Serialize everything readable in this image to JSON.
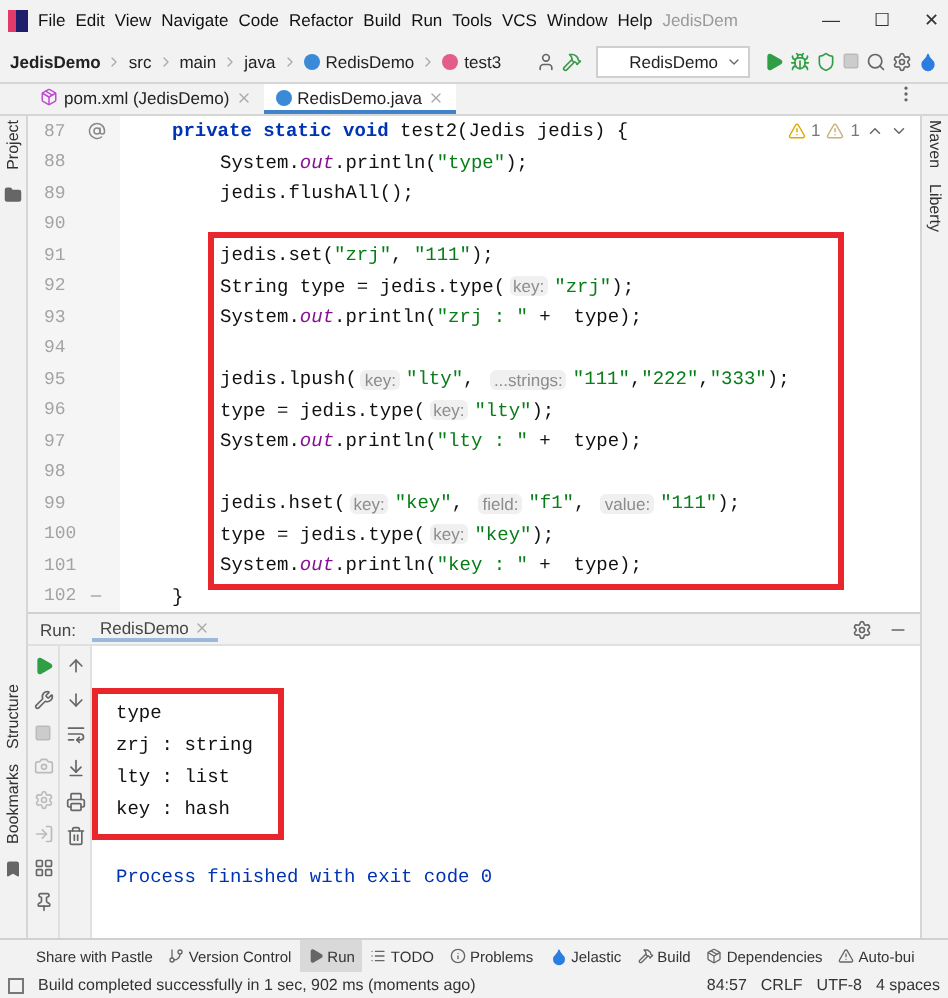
{
  "window": {
    "title": "JedisDem",
    "controls": [
      "—",
      "☐",
      "✕"
    ]
  },
  "menu": [
    "File",
    "Edit",
    "View",
    "Navigate",
    "Code",
    "Refactor",
    "Build",
    "Run",
    "Tools",
    "VCS",
    "Window",
    "Help"
  ],
  "breadcrumbs": [
    {
      "label": "JedisDemo",
      "kind": "project"
    },
    {
      "label": "src",
      "kind": "folder"
    },
    {
      "label": "main",
      "kind": "folder"
    },
    {
      "label": "java",
      "kind": "folder"
    },
    {
      "label": "RedisDemo",
      "kind": "class"
    },
    {
      "label": "test3",
      "kind": "method"
    }
  ],
  "run_config": {
    "label": "RedisDemo"
  },
  "tabs": [
    {
      "label": "pom.xml (JedisDemo)",
      "kind": "maven",
      "selected": false
    },
    {
      "label": "RedisDemo.java",
      "kind": "class",
      "selected": true
    }
  ],
  "inspections": {
    "warnings": "1",
    "weak_warnings": "1"
  },
  "left_strip": {
    "top": "Project",
    "middle": "Structure",
    "bottom": "Bookmarks"
  },
  "right_strip": [
    "Maven",
    "Liberty"
  ],
  "editor": {
    "lines": [
      {
        "kind": "line",
        "number": "87",
        "gutter": {
          "kind": "override"
        },
        "segments": [
          {
            "kind": "keyword",
            "text": "private static void"
          },
          {
            "kind": "plain",
            "text": " test2(Jedis jedis) {"
          }
        ],
        "children": [
          {
            "kind": "line",
            "number": "88",
            "segments": [
              {
                "kind": "plain",
                "text": "System."
              },
              {
                "kind": "field",
                "text": "out"
              },
              {
                "kind": "plain",
                "text": ".println("
              },
              {
                "kind": "string",
                "text": "\"type\""
              },
              {
                "kind": "plain",
                "text": ");"
              }
            ]
          },
          {
            "kind": "line",
            "number": "89",
            "segments": [
              {
                "kind": "plain",
                "text": "jedis.flushAll();"
              }
            ]
          },
          {
            "kind": "line",
            "number": "90"
          },
          {
            "kind": "highlight_box",
            "children": [
              {
                "kind": "line",
                "number": "91",
                "segments": [
                  {
                    "kind": "plain",
                    "text": "jedis.set("
                  },
                  {
                    "kind": "string",
                    "text": "\"zrj\""
                  },
                  {
                    "kind": "plain",
                    "text": ", "
                  },
                  {
                    "kind": "string",
                    "text": "\"111\""
                  },
                  {
                    "kind": "plain",
                    "text": ");"
                  }
                ]
              },
              {
                "kind": "line",
                "number": "92",
                "segments": [
                  {
                    "kind": "plain",
                    "text": "String type = jedis.type("
                  },
                  {
                    "kind": "hint",
                    "text": "key:"
                  },
                  {
                    "kind": "string",
                    "text": "\"zrj\""
                  },
                  {
                    "kind": "plain",
                    "text": ");"
                  }
                ]
              },
              {
                "kind": "line",
                "number": "93",
                "segments": [
                  {
                    "kind": "plain",
                    "text": "System."
                  },
                  {
                    "kind": "field",
                    "text": "out"
                  },
                  {
                    "kind": "plain",
                    "text": ".println("
                  },
                  {
                    "kind": "string",
                    "text": "\"zrj : \""
                  },
                  {
                    "kind": "plain",
                    "text": " +  type);"
                  }
                ]
              },
              {
                "kind": "line",
                "number": "94"
              },
              {
                "kind": "line",
                "number": "95",
                "segments": [
                  {
                    "kind": "plain",
                    "text": "jedis.lpush("
                  },
                  {
                    "kind": "hint",
                    "text": "key:"
                  },
                  {
                    "kind": "string",
                    "text": "\"lty\""
                  },
                  {
                    "kind": "plain",
                    "text": ", "
                  },
                  {
                    "kind": "hint",
                    "text": "...strings:"
                  },
                  {
                    "kind": "string",
                    "text": "\"111\""
                  },
                  {
                    "kind": "plain",
                    "text": ","
                  },
                  {
                    "kind": "string",
                    "text": "\"222\""
                  },
                  {
                    "kind": "plain",
                    "text": ","
                  },
                  {
                    "kind": "string",
                    "text": "\"333\""
                  },
                  {
                    "kind": "plain",
                    "text": ");"
                  }
                ]
              },
              {
                "kind": "line",
                "number": "96",
                "segments": [
                  {
                    "kind": "plain",
                    "text": "type = jedis.type("
                  },
                  {
                    "kind": "hint",
                    "text": "key:"
                  },
                  {
                    "kind": "string",
                    "text": "\"lty\""
                  },
                  {
                    "kind": "plain",
                    "text": ");"
                  }
                ]
              },
              {
                "kind": "line",
                "number": "97",
                "segments": [
                  {
                    "kind": "plain",
                    "text": "System."
                  },
                  {
                    "kind": "field",
                    "text": "out"
                  },
                  {
                    "kind": "plain",
                    "text": ".println("
                  },
                  {
                    "kind": "string",
                    "text": "\"lty : \""
                  },
                  {
                    "kind": "plain",
                    "text": " +  type);"
                  }
                ]
              },
              {
                "kind": "line",
                "number": "98"
              },
              {
                "kind": "line",
                "number": "99",
                "segments": [
                  {
                    "kind": "plain",
                    "text": "jedis.hset("
                  },
                  {
                    "kind": "hint",
                    "text": "key:"
                  },
                  {
                    "kind": "string",
                    "text": "\"key\""
                  },
                  {
                    "kind": "plain",
                    "text": ", "
                  },
                  {
                    "kind": "hint",
                    "text": "field:"
                  },
                  {
                    "kind": "string",
                    "text": "\"f1\""
                  },
                  {
                    "kind": "plain",
                    "text": ", "
                  },
                  {
                    "kind": "hint",
                    "text": "value:"
                  },
                  {
                    "kind": "string",
                    "text": "\"111\""
                  },
                  {
                    "kind": "plain",
                    "text": ");"
                  }
                ]
              },
              {
                "kind": "line",
                "number": "100",
                "segments": [
                  {
                    "kind": "plain",
                    "text": "type = jedis.type("
                  },
                  {
                    "kind": "hint",
                    "text": "key:"
                  },
                  {
                    "kind": "string",
                    "text": "\"key\""
                  },
                  {
                    "kind": "plain",
                    "text": ");"
                  }
                ]
              },
              {
                "kind": "line",
                "number": "101",
                "segments": [
                  {
                    "kind": "plain",
                    "text": "System."
                  },
                  {
                    "kind": "field",
                    "text": "out"
                  },
                  {
                    "kind": "plain",
                    "text": ".println("
                  },
                  {
                    "kind": "string",
                    "text": "\"key : \""
                  },
                  {
                    "kind": "plain",
                    "text": " +  type);"
                  }
                ]
              }
            ]
          }
        ]
      },
      {
        "kind": "line",
        "number": "102",
        "gutter": {
          "kind": "fold"
        },
        "segments": [
          {
            "kind": "plain",
            "text": "}"
          }
        ]
      }
    ]
  },
  "run_panel": {
    "label": "Run:",
    "tab": "RedisDemo",
    "output": [
      {
        "kind": "highlight_box",
        "children": [
          {
            "kind": "stdout",
            "text": "type"
          },
          {
            "kind": "stdout",
            "text": "zrj : string"
          },
          {
            "kind": "stdout",
            "text": "lty : list"
          },
          {
            "kind": "stdout",
            "text": "key : hash"
          }
        ]
      },
      {
        "kind": "exit",
        "text": "Process finished with exit code 0"
      }
    ]
  },
  "tool_tabs": [
    {
      "label": "Share with Pastle",
      "kind": "none",
      "selected": false
    },
    {
      "label": "Version Control",
      "kind": "vcs",
      "selected": false
    },
    {
      "label": "Run",
      "kind": "run",
      "selected": true
    },
    {
      "label": "TODO",
      "kind": "todo",
      "selected": false
    },
    {
      "label": "Problems",
      "kind": "problems",
      "selected": false
    },
    {
      "label": "Jelastic",
      "kind": "jelastic",
      "selected": false
    },
    {
      "label": "Build",
      "kind": "build",
      "selected": false
    },
    {
      "label": "Dependencies",
      "kind": "dependencies",
      "selected": false
    },
    {
      "label": "Auto-bui",
      "kind": "warning",
      "selected": false
    }
  ],
  "status_bar": {
    "message": "Build completed successfully in 1 sec, 902 ms (moments ago)",
    "position": "84:57",
    "line_separator": "CRLF",
    "encoding": "UTF-8",
    "indent": "4 spaces"
  }
}
